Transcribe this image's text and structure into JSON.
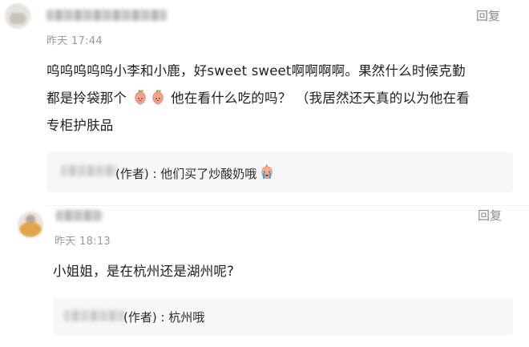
{
  "comments": [
    {
      "time": "昨天 17:44",
      "reply_label": "回复",
      "text_parts": {
        "line1": "呜呜呜呜呜小李和小鹿，好sweet sweet啊啊啊啊。果然什么时候克勤",
        "line2_before": "都是拎袋那个",
        "line2_after": "他在看什么吃的吗？ （我居然还天真的以为他在看",
        "line3": "专柜护肤品"
      },
      "emoji": [
        "peach-face-icon",
        "peach-face-icon"
      ],
      "author_reply": {
        "name_suffix": "(作者) : ",
        "text": "他们买了炒酸奶哦",
        "emoji": "crying-face-icon"
      }
    },
    {
      "time": "昨天 18:13",
      "reply_label": "回复",
      "text": "小姐姐，是在杭州还是湖州呢?",
      "author_reply": {
        "name_suffix": "(作者) : ",
        "text": "杭州哦"
      }
    }
  ],
  "colors": {
    "time": "#9a9a9a",
    "reply_button": "#8a8a8a",
    "reply_box": "#f7f7f7"
  }
}
